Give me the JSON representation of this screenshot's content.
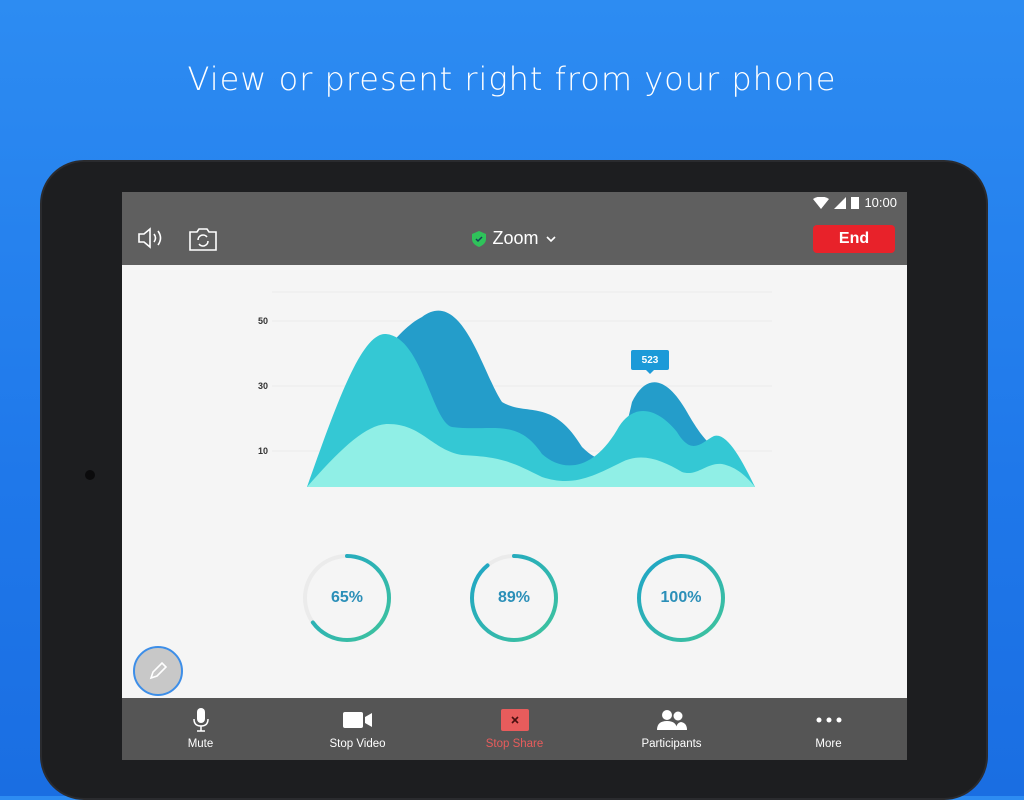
{
  "headline": "View or present right from your phone",
  "status": {
    "time": "10:00"
  },
  "topbar": {
    "title": "Zoom",
    "end_label": "End"
  },
  "chart": {
    "y_ticks": [
      "50",
      "30",
      "10"
    ],
    "tooltip": "523"
  },
  "progress": [
    {
      "label": "65%",
      "value": 65
    },
    {
      "label": "89%",
      "value": 89
    },
    {
      "label": "100%",
      "value": 100
    }
  ],
  "bottombar": {
    "items": [
      {
        "label": "Mute"
      },
      {
        "label": "Stop Video"
      },
      {
        "label": "Stop Share"
      },
      {
        "label": "Participants"
      },
      {
        "label": "More"
      }
    ]
  },
  "colors": {
    "end": "#e8222a",
    "stop_share": "#e85c5c",
    "series_dark": "#249dca",
    "series_mid": "#34c8d4",
    "series_light": "#90efe6"
  }
}
